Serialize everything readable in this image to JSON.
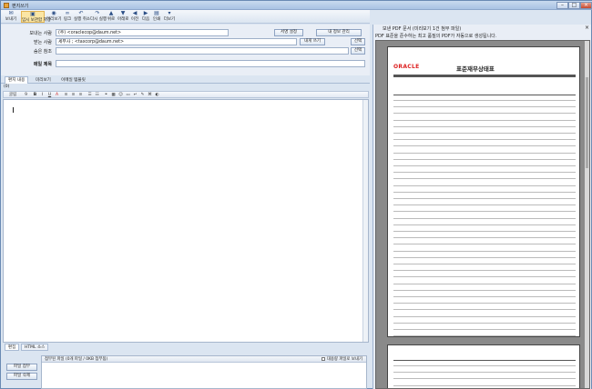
{
  "window": {
    "title": "편지쓰기"
  },
  "toolbar": {
    "items": [
      {
        "icon": "send-icon",
        "label": "보내기",
        "glyph": "✉"
      },
      {
        "icon": "save-icon",
        "label": "임시 보관함 저장",
        "glyph": "▣"
      },
      {
        "icon": "preview-icon",
        "label": "미리보기",
        "glyph": "◉"
      },
      {
        "icon": "link-icon",
        "label": "링크",
        "glyph": "∞"
      },
      {
        "icon": "undo-icon",
        "label": "실행 취소",
        "glyph": "↶"
      },
      {
        "icon": "redo-icon",
        "label": "다시 실행",
        "glyph": "↷"
      },
      {
        "icon": "up-icon",
        "label": "위로",
        "glyph": "▲"
      },
      {
        "icon": "down-icon",
        "label": "아래로",
        "glyph": "▼"
      },
      {
        "icon": "prev-icon",
        "label": "이전",
        "glyph": "◀"
      },
      {
        "icon": "next-icon",
        "label": "다음",
        "glyph": "▶"
      },
      {
        "icon": "print-icon",
        "label": "인쇄",
        "glyph": "▤"
      },
      {
        "icon": "more-icon",
        "label": "더보기",
        "glyph": "▾"
      }
    ]
  },
  "form": {
    "from_label": "보내는 사람",
    "from_value": "(주)  <oraclecop@daum.net>",
    "sign_button": "서명 설정",
    "sender_button": "내 정보 관리",
    "to_label": "받는 사람",
    "to_value": "세무사  ;  <taxcorp@daum.net>",
    "to_me_button": "내게 쓰기",
    "to_select_button": "선택",
    "cc_label": "숨은 참조",
    "cc_select_button": "선택",
    "subject_label": "메일 제목",
    "subject_value": ""
  },
  "tabs": {
    "items": [
      "편지 내용",
      "미리보기",
      "이메일 템플릿"
    ]
  },
  "subline": "(0)",
  "editor_tools": [
    "굴림",
    "9",
    "B",
    "I",
    "U",
    "A",
    "≡",
    "≡",
    "≡",
    "☰",
    "☷",
    "⚭",
    "▦",
    "☺",
    "▭",
    "↵",
    "✎",
    "⌘",
    "◐"
  ],
  "modes": [
    "편집",
    "HTML 소스"
  ],
  "attach": {
    "add_button": "파일 첨부",
    "remove_button": "파일 삭제",
    "header": "첨부된 파일 (0개 파일 / 0KB 첨부됨)",
    "option": "대용량 파일로 보내기"
  },
  "viewer": {
    "title": "보낸 PDF 문서 (미리보기 1건 첨부 파일)",
    "subtitle": "PDF 표준을 준수하는 최고 품질의 PDF가 자동으로 생성됩니다.",
    "doc_title": "표준재무상태표",
    "brand": "ORACLE"
  },
  "colors": {
    "accent": "#2c4f86",
    "brand_red": "#d22222",
    "viewer_bg": "#8a8a8a"
  }
}
